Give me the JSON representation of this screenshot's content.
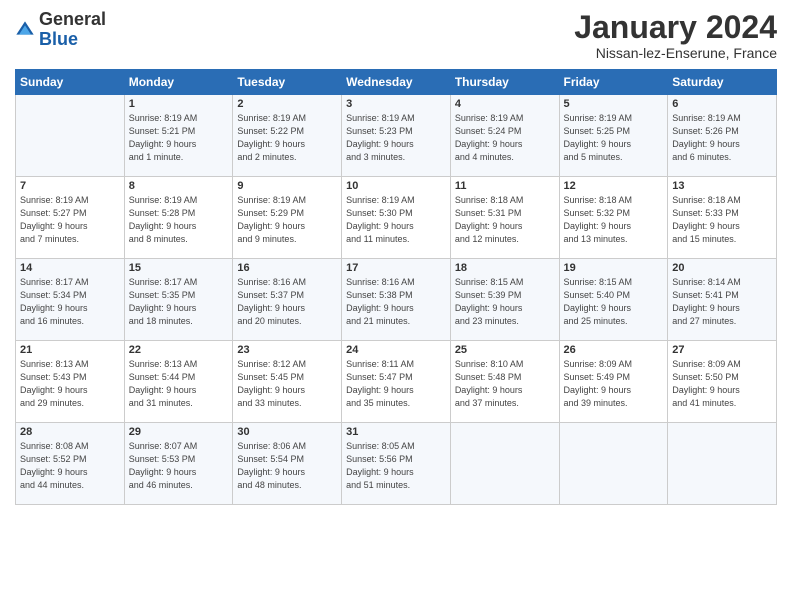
{
  "header": {
    "logo_general": "General",
    "logo_blue": "Blue",
    "month_title": "January 2024",
    "subtitle": "Nissan-lez-Enserune, France"
  },
  "days_of_week": [
    "Sunday",
    "Monday",
    "Tuesday",
    "Wednesday",
    "Thursday",
    "Friday",
    "Saturday"
  ],
  "weeks": [
    [
      {
        "day": "",
        "info": ""
      },
      {
        "day": "1",
        "info": "Sunrise: 8:19 AM\nSunset: 5:21 PM\nDaylight: 9 hours\nand 1 minute."
      },
      {
        "day": "2",
        "info": "Sunrise: 8:19 AM\nSunset: 5:22 PM\nDaylight: 9 hours\nand 2 minutes."
      },
      {
        "day": "3",
        "info": "Sunrise: 8:19 AM\nSunset: 5:23 PM\nDaylight: 9 hours\nand 3 minutes."
      },
      {
        "day": "4",
        "info": "Sunrise: 8:19 AM\nSunset: 5:24 PM\nDaylight: 9 hours\nand 4 minutes."
      },
      {
        "day": "5",
        "info": "Sunrise: 8:19 AM\nSunset: 5:25 PM\nDaylight: 9 hours\nand 5 minutes."
      },
      {
        "day": "6",
        "info": "Sunrise: 8:19 AM\nSunset: 5:26 PM\nDaylight: 9 hours\nand 6 minutes."
      }
    ],
    [
      {
        "day": "7",
        "info": "Sunrise: 8:19 AM\nSunset: 5:27 PM\nDaylight: 9 hours\nand 7 minutes."
      },
      {
        "day": "8",
        "info": "Sunrise: 8:19 AM\nSunset: 5:28 PM\nDaylight: 9 hours\nand 8 minutes."
      },
      {
        "day": "9",
        "info": "Sunrise: 8:19 AM\nSunset: 5:29 PM\nDaylight: 9 hours\nand 9 minutes."
      },
      {
        "day": "10",
        "info": "Sunrise: 8:19 AM\nSunset: 5:30 PM\nDaylight: 9 hours\nand 11 minutes."
      },
      {
        "day": "11",
        "info": "Sunrise: 8:18 AM\nSunset: 5:31 PM\nDaylight: 9 hours\nand 12 minutes."
      },
      {
        "day": "12",
        "info": "Sunrise: 8:18 AM\nSunset: 5:32 PM\nDaylight: 9 hours\nand 13 minutes."
      },
      {
        "day": "13",
        "info": "Sunrise: 8:18 AM\nSunset: 5:33 PM\nDaylight: 9 hours\nand 15 minutes."
      }
    ],
    [
      {
        "day": "14",
        "info": "Sunrise: 8:17 AM\nSunset: 5:34 PM\nDaylight: 9 hours\nand 16 minutes."
      },
      {
        "day": "15",
        "info": "Sunrise: 8:17 AM\nSunset: 5:35 PM\nDaylight: 9 hours\nand 18 minutes."
      },
      {
        "day": "16",
        "info": "Sunrise: 8:16 AM\nSunset: 5:37 PM\nDaylight: 9 hours\nand 20 minutes."
      },
      {
        "day": "17",
        "info": "Sunrise: 8:16 AM\nSunset: 5:38 PM\nDaylight: 9 hours\nand 21 minutes."
      },
      {
        "day": "18",
        "info": "Sunrise: 8:15 AM\nSunset: 5:39 PM\nDaylight: 9 hours\nand 23 minutes."
      },
      {
        "day": "19",
        "info": "Sunrise: 8:15 AM\nSunset: 5:40 PM\nDaylight: 9 hours\nand 25 minutes."
      },
      {
        "day": "20",
        "info": "Sunrise: 8:14 AM\nSunset: 5:41 PM\nDaylight: 9 hours\nand 27 minutes."
      }
    ],
    [
      {
        "day": "21",
        "info": "Sunrise: 8:13 AM\nSunset: 5:43 PM\nDaylight: 9 hours\nand 29 minutes."
      },
      {
        "day": "22",
        "info": "Sunrise: 8:13 AM\nSunset: 5:44 PM\nDaylight: 9 hours\nand 31 minutes."
      },
      {
        "day": "23",
        "info": "Sunrise: 8:12 AM\nSunset: 5:45 PM\nDaylight: 9 hours\nand 33 minutes."
      },
      {
        "day": "24",
        "info": "Sunrise: 8:11 AM\nSunset: 5:47 PM\nDaylight: 9 hours\nand 35 minutes."
      },
      {
        "day": "25",
        "info": "Sunrise: 8:10 AM\nSunset: 5:48 PM\nDaylight: 9 hours\nand 37 minutes."
      },
      {
        "day": "26",
        "info": "Sunrise: 8:09 AM\nSunset: 5:49 PM\nDaylight: 9 hours\nand 39 minutes."
      },
      {
        "day": "27",
        "info": "Sunrise: 8:09 AM\nSunset: 5:50 PM\nDaylight: 9 hours\nand 41 minutes."
      }
    ],
    [
      {
        "day": "28",
        "info": "Sunrise: 8:08 AM\nSunset: 5:52 PM\nDaylight: 9 hours\nand 44 minutes."
      },
      {
        "day": "29",
        "info": "Sunrise: 8:07 AM\nSunset: 5:53 PM\nDaylight: 9 hours\nand 46 minutes."
      },
      {
        "day": "30",
        "info": "Sunrise: 8:06 AM\nSunset: 5:54 PM\nDaylight: 9 hours\nand 48 minutes."
      },
      {
        "day": "31",
        "info": "Sunrise: 8:05 AM\nSunset: 5:56 PM\nDaylight: 9 hours\nand 51 minutes."
      },
      {
        "day": "",
        "info": ""
      },
      {
        "day": "",
        "info": ""
      },
      {
        "day": "",
        "info": ""
      }
    ]
  ]
}
